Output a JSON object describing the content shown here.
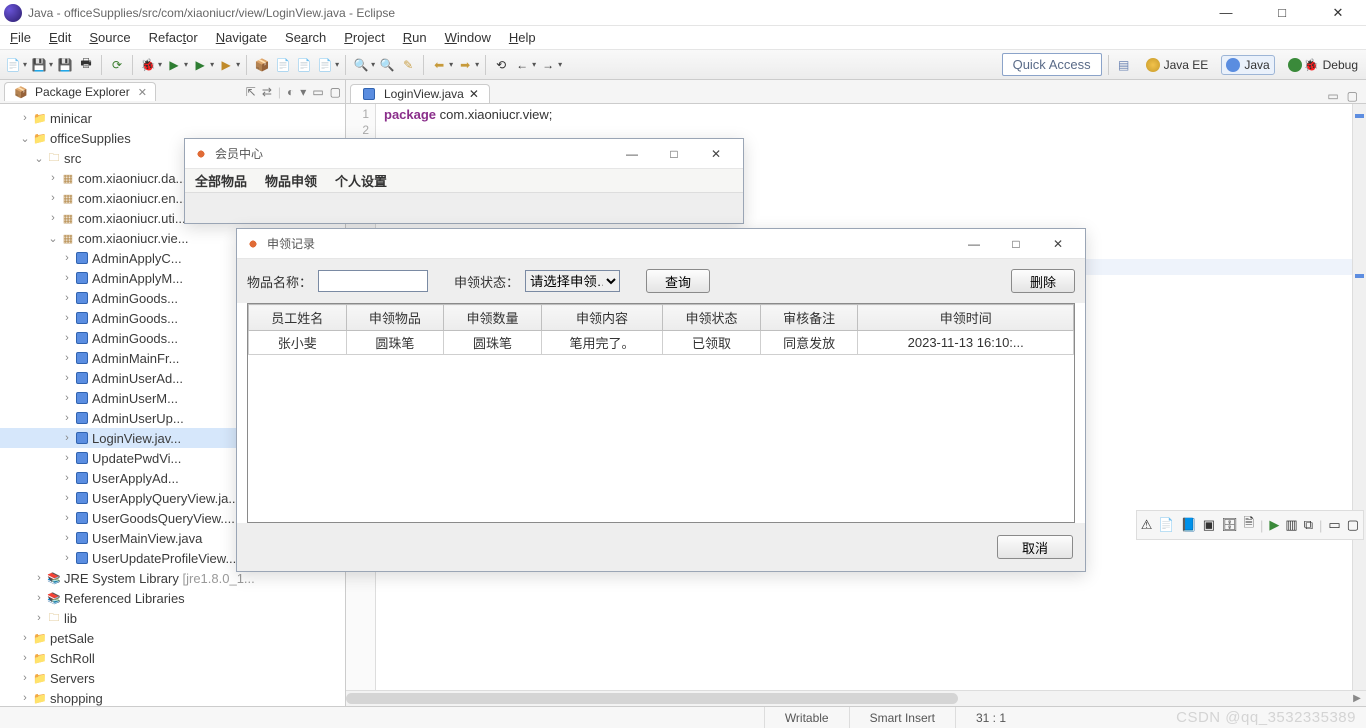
{
  "window": {
    "title": "Java - officeSupplies/src/com/xiaoniucr/view/LoginView.java - Eclipse"
  },
  "menus": {
    "file": "File",
    "edit": "Edit",
    "source": "Source",
    "refactor": "Refactor",
    "navigate": "Navigate",
    "search": "Search",
    "project": "Project",
    "run": "Run",
    "window": "Window",
    "help": "Help"
  },
  "toolbar": {
    "quick_access": "Quick Access",
    "persp_javaee": "Java EE",
    "persp_java": "Java",
    "persp_debug": "Debug"
  },
  "pkg_view": {
    "title": "Package Explorer"
  },
  "tree": {
    "p_minicar": "minicar",
    "p_officeSupplies": "officeSupplies",
    "src": "src",
    "pkg_da": "com.xiaoniucr.da...",
    "pkg_en": "com.xiaoniucr.en...",
    "pkg_uti": "com.xiaoniucr.uti...",
    "pkg_view": "com.xiaoniucr.vie...",
    "c_AdminApplyC": "AdminApplyC...",
    "c_AdminApplyM": "AdminApplyM...",
    "c_AdminGoods1": "AdminGoods...",
    "c_AdminGoods2": "AdminGoods...",
    "c_AdminGoods3": "AdminGoods...",
    "c_AdminMainFr": "AdminMainFr...",
    "c_AdminUserAd": "AdminUserAd...",
    "c_AdminUserM": "AdminUserM...",
    "c_AdminUserUp": "AdminUserUp...",
    "c_LoginView": "LoginView.jav...",
    "c_UpdatePwdVi": "UpdatePwdVi...",
    "c_UserApplyAd": "UserApplyAd...",
    "c_UserApplyQueryView": "UserApplyQueryView.ja...",
    "c_UserGoodsQueryView": "UserGoodsQueryView....",
    "c_UserMainView": "UserMainView.java",
    "c_UserUpdateProfileView": "UserUpdateProfileView...",
    "jre": "JRE System Library",
    "jre_suffix": "[jre1.8.0_1...",
    "reflib": "Referenced Libraries",
    "lib": "lib",
    "p_petSale": "petSale",
    "p_SchRoll": "SchRoll",
    "p_Servers": "Servers",
    "p_shopping": "shopping"
  },
  "editor": {
    "tab": "LoginView.java",
    "line1_kw": "package",
    "line1_rest": " com.xiaoniucr.view;",
    "ln1": "1",
    "ln2": "2"
  },
  "dialog1": {
    "title": "会员中心",
    "menu_all": "全部物品",
    "menu_apply": "物品申领",
    "menu_profile": "个人设置"
  },
  "dialog2": {
    "title": "申领记录",
    "lbl_name": "物品名称：",
    "name_value": "",
    "lbl_status": "申领状态：",
    "status_selected": "请选择申领…",
    "btn_query": "查询",
    "btn_delete": "删除",
    "headers": {
      "h1": "员工姓名",
      "h2": "申领物品",
      "h3": "申领数量",
      "h4": "申领内容",
      "h5": "申领状态",
      "h6": "审核备注",
      "h7": "申领时间"
    },
    "row": {
      "c1": "张小斐",
      "c2": "圆珠笔",
      "c3": "圆珠笔",
      "c4": "笔用完了。",
      "c5": "已领取",
      "c6": "同意发放",
      "c7": "2023-11-13 16:10:..."
    },
    "btn_cancel": "取消"
  },
  "status": {
    "writable": "Writable",
    "insert": "Smart Insert",
    "pos": "31 : 1"
  },
  "watermark": "CSDN @qq_3532335389"
}
